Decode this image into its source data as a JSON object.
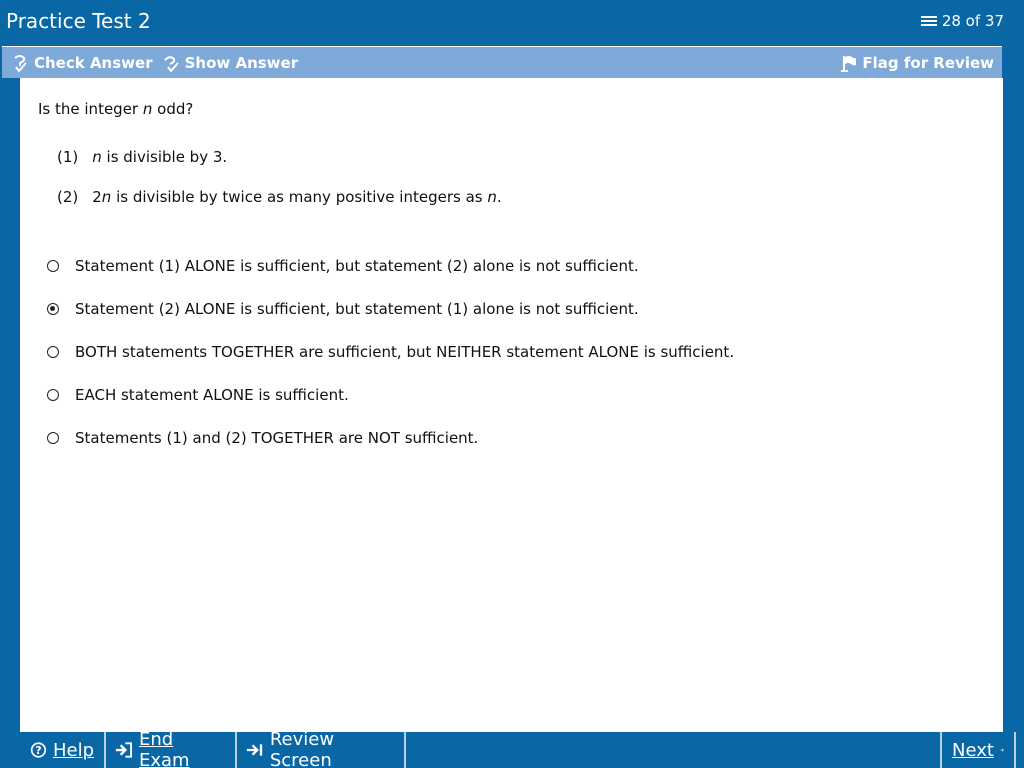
{
  "window": {
    "title": "Practice Test 2",
    "progress": "28 of 37"
  },
  "toolbar": {
    "check_answer": "Check Answer",
    "show_answer": "Show Answer",
    "flag_for_review": "Flag for Review"
  },
  "question": {
    "prompt_before": "Is the integer ",
    "prompt_var": "n",
    "prompt_after": " odd?",
    "statements": [
      {
        "num": "(1)",
        "var": "n",
        "text": " is divisible by 3."
      },
      {
        "num": "(2)",
        "prefix": "2",
        "var": "n",
        "text": " is divisible by twice as many positive integers as ",
        "var2": "n",
        "suffix": "."
      }
    ]
  },
  "choices": [
    {
      "label": "Statement (1) ALONE is sufficient, but statement (2) alone is not sufficient.",
      "selected": false
    },
    {
      "label": "Statement (2) ALONE is sufficient, but statement (1) alone is not sufficient.",
      "selected": true
    },
    {
      "label": "BOTH statements TOGETHER are sufficient, but NEITHER statement ALONE is sufficient.",
      "selected": false
    },
    {
      "label": "EACH statement ALONE is sufficient.",
      "selected": false
    },
    {
      "label": "Statements (1) and (2) TOGETHER are NOT sufficient.",
      "selected": false
    }
  ],
  "bottombar": {
    "help": "Help",
    "end_exam": "End Exam",
    "review_screen": "Review Screen",
    "next": "Next"
  },
  "colors": {
    "frame": "#0a67a6",
    "toolbar": "#7fa9d8",
    "content_bg": "#ffffff"
  }
}
